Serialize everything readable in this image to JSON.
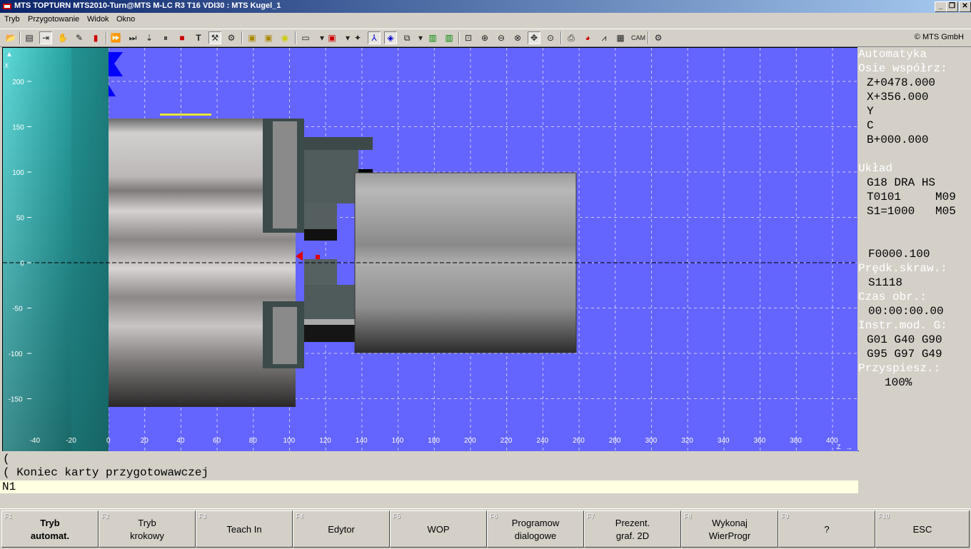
{
  "window": {
    "title": "MTS TOPTURN MTS2010-Turn@MTS M-LC R3 T16 VDI30 : MTS Kugel_1",
    "minimize": "_",
    "restore": "❐",
    "close": "✕"
  },
  "menu": [
    "Tryb",
    "Przygotowanie",
    "Widok",
    "Okno"
  ],
  "toolbar": {
    "copyright": "© MTS GmbH",
    "icons": [
      "open-icon",
      "list-icon",
      "step-icon",
      "hand-icon",
      "brush-icon",
      "fast-forward-icon",
      "play-icon",
      "jog-icon",
      "pause-icon",
      "stop-icon",
      "text-tool-icon",
      "tool-change-icon",
      "tool-icon",
      "machine-1-icon",
      "machine-2-icon",
      "machine-3-icon",
      "window-icon",
      "box-icon",
      "wizard-icon",
      "axes-icon",
      "cube-icon",
      "view-3d-icon",
      "bar-chart-icon",
      "bar-chart-2-icon",
      "zoom-window-icon",
      "zoom-in-icon",
      "zoom-out-icon",
      "zoom-fit-icon",
      "pan-icon",
      "zoom-reset-icon",
      "print-icon",
      "pie-chart-icon",
      "chart-icon",
      "report-icon",
      "cam-icon",
      "settings-icon"
    ],
    "text_tool": "T",
    "cam": "CAM"
  },
  "view": {
    "x_ticks": [
      "-40",
      "-20",
      "0",
      "20",
      "40",
      "60",
      "80",
      "100",
      "120",
      "140",
      "160",
      "180",
      "200",
      "220",
      "240",
      "260",
      "280",
      "300",
      "320",
      "340",
      "360",
      "380",
      "400"
    ],
    "y_ticks": [
      "200",
      "150",
      "100",
      "50",
      "0",
      "-50",
      "-100",
      "-150"
    ],
    "z_label": "Z",
    "x_label": "X",
    "colors": {
      "background": "#6464ff",
      "grid": "#c8c8ff"
    }
  },
  "info": {
    "mode": "Automatyka",
    "axes_label": "Osie współrz:",
    "z": "Z+0478.000",
    "x": "X+356.000",
    "y": "Y",
    "c": "C",
    "b": "B+000.000",
    "uklad_label": "Układ",
    "g18": "G18 DRA HS",
    "tool": "T0101     M09",
    "spindle": "S1=1000   M05",
    "feed": "F0000.100",
    "cut_speed_label": "Prędk.skraw.:",
    "cut_speed": "S1118",
    "time_label": "Czas obr.:",
    "time": "00:00:00.00",
    "gmod_label": "Instr.mod. G:",
    "gmod1": "G01 G40 G90",
    "gmod2": "G95 G97 G49",
    "accel_label": "Przyspiesz.:",
    "accel": "100%"
  },
  "command": {
    "line1": "(",
    "line2": "( Koniec karty przygotowawczej",
    "current": "N1"
  },
  "fkeys": [
    {
      "num": "F1",
      "label": "Tryb\nautomat."
    },
    {
      "num": "F2",
      "label": "Tryb\nkrokowy"
    },
    {
      "num": "F3",
      "label": "Teach In"
    },
    {
      "num": "F4",
      "label": "Edytor"
    },
    {
      "num": "F5",
      "label": "WOP"
    },
    {
      "num": "F6",
      "label": "Programow\ndialogowe"
    },
    {
      "num": "F7",
      "label": "Prezent.\ngraf. 2D"
    },
    {
      "num": "F8",
      "label": "Wykonaj\nWierProgr"
    },
    {
      "num": "F9",
      "label": "?"
    },
    {
      "num": "F10",
      "label": "ESC"
    }
  ]
}
